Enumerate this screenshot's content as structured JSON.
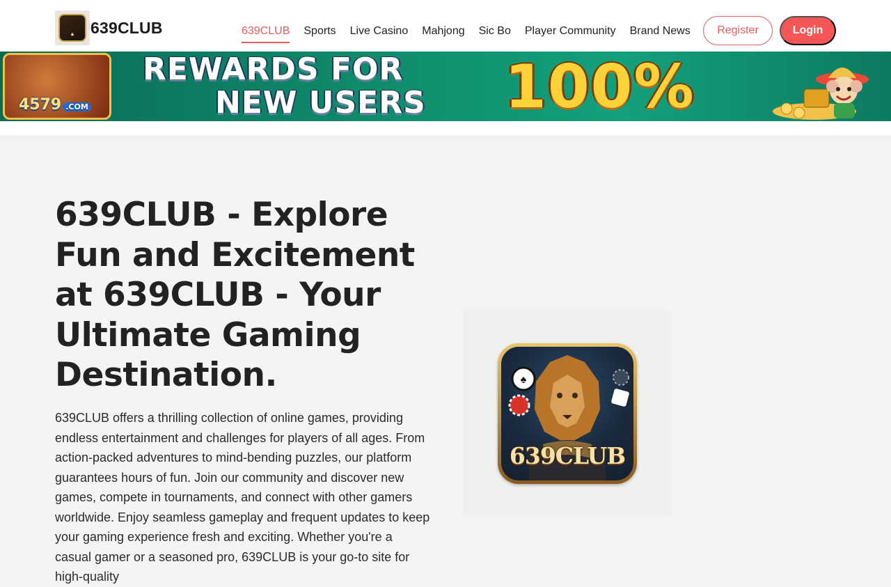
{
  "header": {
    "brand_name": "639CLUB",
    "nav": [
      {
        "label": "639CLUB",
        "active": true
      },
      {
        "label": "Sports"
      },
      {
        "label": "Live Casino"
      },
      {
        "label": "Mahjong"
      },
      {
        "label": "Sic Bo"
      },
      {
        "label": "Player Community"
      },
      {
        "label": "Brand News"
      }
    ],
    "register_label": "Register",
    "login_label": "Login"
  },
  "banner": {
    "badge_site": "4579",
    "badge_domain": ".COM",
    "title_line1": "REWARDS FOR",
    "title_line2": "NEW USERS",
    "percent": "100%"
  },
  "hero": {
    "title": "639CLUB - Explore Fun and Excitement at 639CLUB - Your Ultimate Gaming Destination.",
    "text": "639CLUB offers a thrilling collection of online games, providing endless entertainment and challenges for players of all ages. From action-packed adventures to mind-bending puzzles, our platform guarantees hours of fun. Join our community and discover new games, compete in tournaments, and connect with other gamers worldwide. Enjoy seamless gameplay and frequent updates to keep your gaming experience fresh and exciting. Whether you're a casual gamer or a seasoned pro, 639CLUB is your go-to site for high-quality",
    "icon_label": "639CLUB"
  },
  "colors": {
    "accent": "#f25656",
    "banner_green": "#0f8a6a"
  }
}
